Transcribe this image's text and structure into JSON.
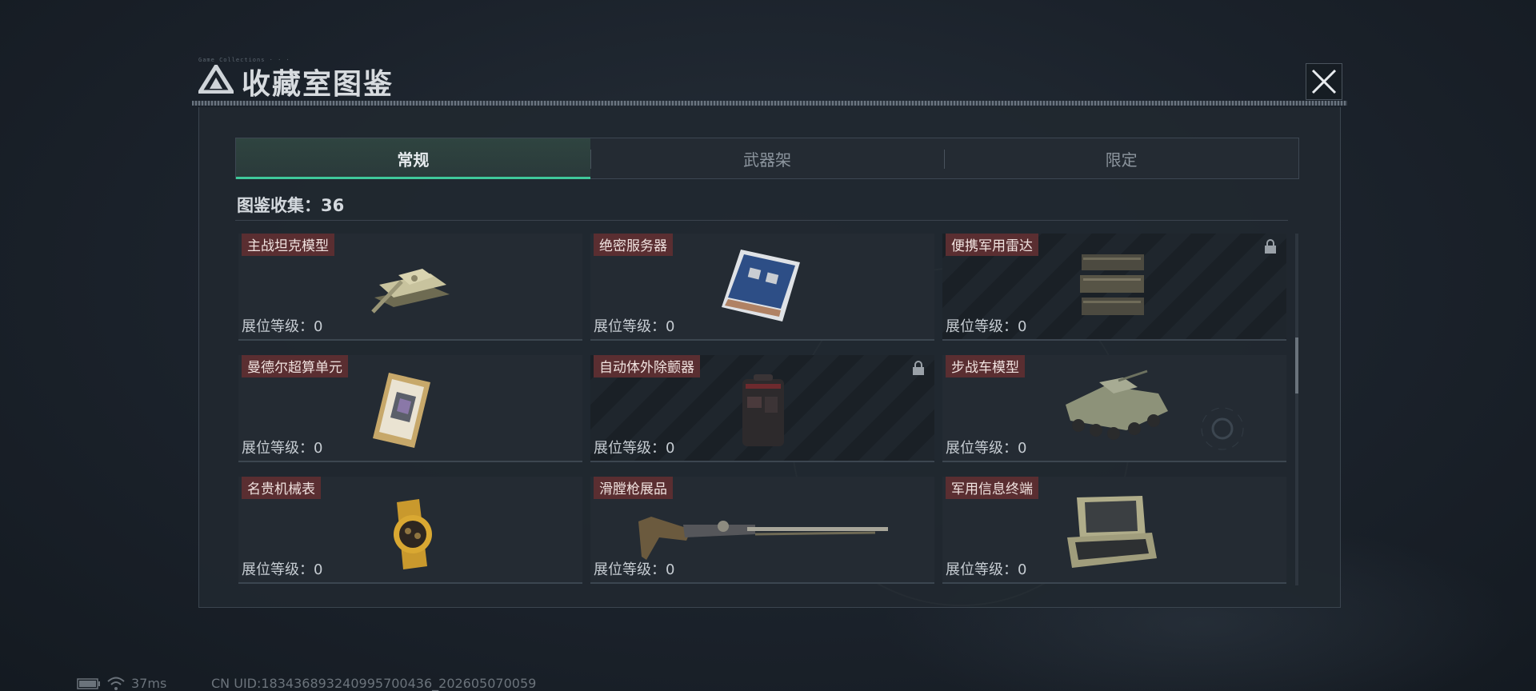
{
  "window": {
    "title": "收藏室图鉴",
    "header_tiny": "Game Collections · · ·",
    "close_icon": "close-x-icon"
  },
  "tabs": [
    {
      "label": "常规",
      "active": true
    },
    {
      "label": "武器架",
      "active": false
    },
    {
      "label": "限定",
      "active": false
    }
  ],
  "collection": {
    "label": "图鉴收集：36"
  },
  "items": [
    {
      "name": "主战坦克模型",
      "level": "展位等级：0",
      "locked": false,
      "icon": "tank-model-icon"
    },
    {
      "name": "绝密服务器",
      "level": "展位等级：0",
      "locked": false,
      "icon": "server-icon"
    },
    {
      "name": "便携军用雷达",
      "level": "展位等级：0",
      "locked": true,
      "icon": "radar-icon"
    },
    {
      "name": "曼德尔超算单元",
      "level": "展位等级：0",
      "locked": false,
      "icon": "supercomputer-unit-icon"
    },
    {
      "name": "自动体外除颤器",
      "level": "展位等级：0",
      "locked": true,
      "icon": "defibrillator-icon"
    },
    {
      "name": "步战车模型",
      "level": "展位等级：0",
      "locked": false,
      "icon": "ifv-model-icon"
    },
    {
      "name": "名贵机械表",
      "level": "展位等级：0",
      "locked": false,
      "icon": "watch-icon"
    },
    {
      "name": "滑膛枪展品",
      "level": "展位等级：0",
      "locked": false,
      "icon": "musket-icon"
    },
    {
      "name": "军用信息终端",
      "level": "展位等级：0",
      "locked": false,
      "icon": "terminal-icon"
    }
  ],
  "status": {
    "ping": "37ms",
    "uid": "CN UID:1834368932409957004­36_202605070059"
  },
  "colors": {
    "accent": "#3fc99a",
    "name_tag_bg": "#5a2e31",
    "panel_bg": "#212830"
  }
}
